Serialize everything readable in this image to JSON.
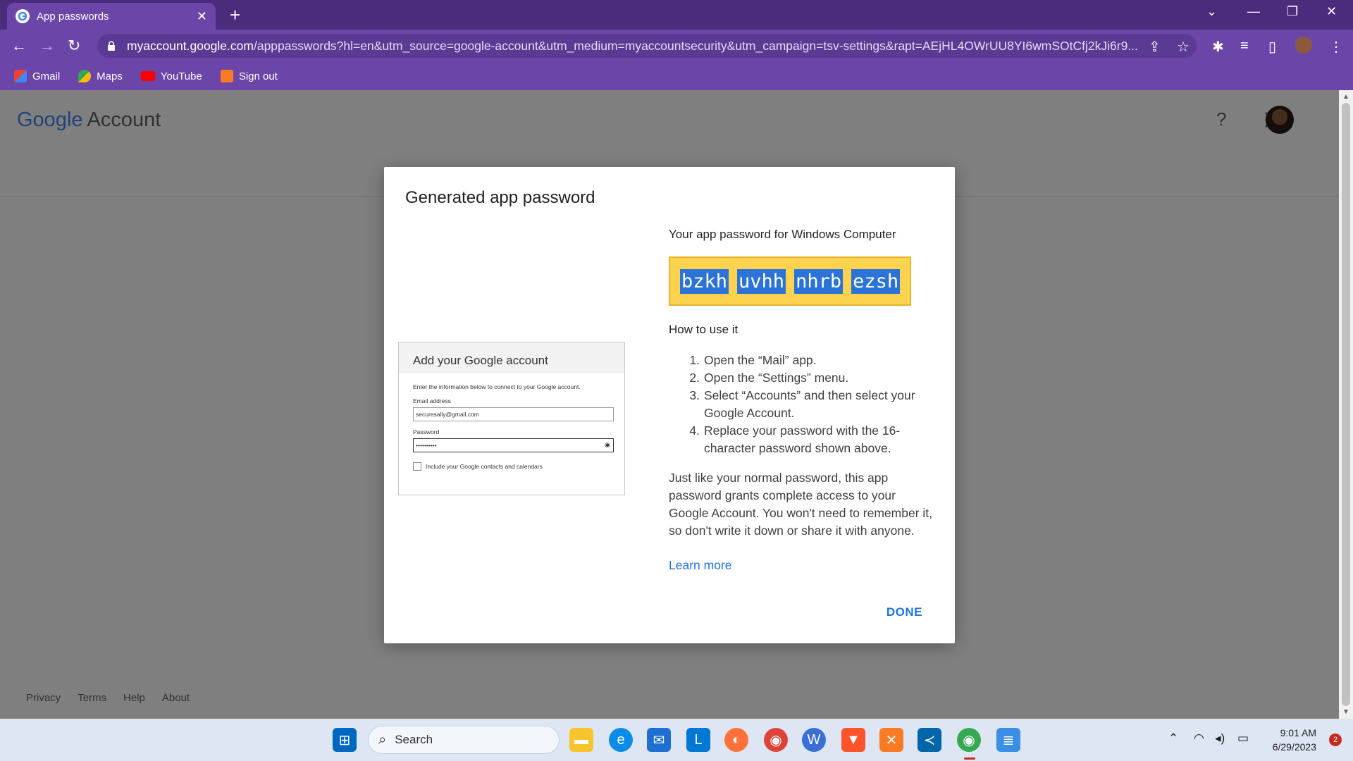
{
  "browser": {
    "tab_title": "App passwords",
    "url_host": "myaccount.google.com",
    "url_rest": "/apppasswords?hl=en&utm_source=google-account&utm_medium=myaccountsecurity&utm_campaign=tsv-settings&rapt=AEjHL4OWrUU8YI6wmSOtCfj2kJi6r9...",
    "bookmarks": [
      {
        "label": "Gmail",
        "icon": "gmail-icon"
      },
      {
        "label": "Maps",
        "icon": "maps-icon"
      },
      {
        "label": "YouTube",
        "icon": "youtube-icon"
      },
      {
        "label": "Sign out",
        "icon": "xampp-icon"
      }
    ],
    "theme_color": "#6c45a8"
  },
  "page": {
    "brand_google": "Google",
    "brand_account": "Account",
    "footer_links": [
      "Privacy",
      "Terms",
      "Help",
      "About"
    ]
  },
  "dialog": {
    "title": "Generated app password",
    "password_for": "Your app password for Windows Computer",
    "password_chunks": [
      "bzkh",
      "uvhh",
      "nhrb",
      "ezsh"
    ],
    "how_title": "How to use it",
    "steps": [
      "Open the “Mail” app.",
      "Open the “Settings” menu.",
      "Select “Accounts” and then select your Google Account.",
      "Replace your password with the 16-character password shown above."
    ],
    "paragraph": "Just like your normal password, this app password grants complete access to your Google Account. You won't need to remember it, so don't write it down or share it with anyone.",
    "learn_more": "Learn more",
    "done_label": "DONE",
    "mock": {
      "header": "Add your Google account",
      "intro": "Enter the information below to connect to your Google account.",
      "email_label": "Email address",
      "email_value": "securesally@gmail.com",
      "password_label": "Password",
      "password_value": "••••••••••",
      "checkbox_label": "Include your Google contacts and calendars"
    }
  },
  "taskbar": {
    "search_placeholder": "Search",
    "time": "9:01 AM",
    "date": "6/29/2023",
    "notifications": "2"
  }
}
